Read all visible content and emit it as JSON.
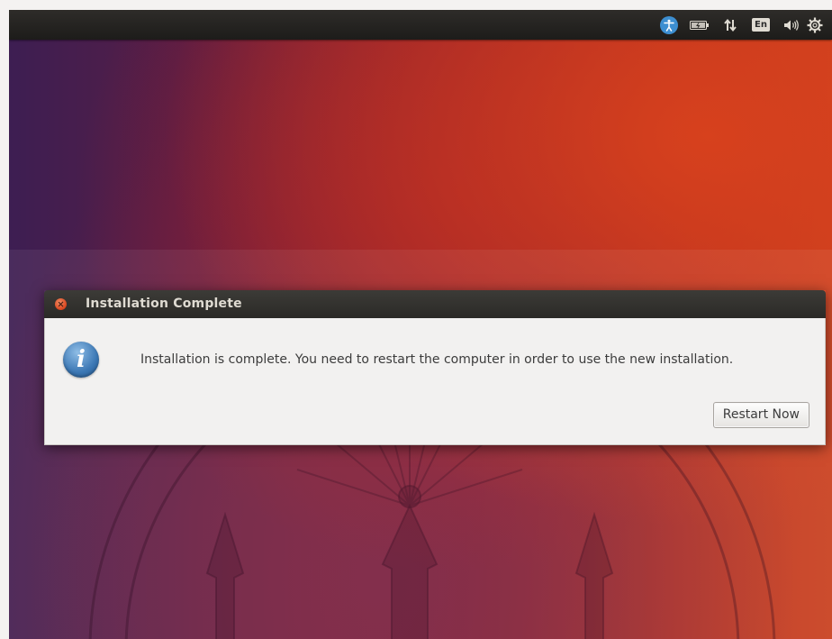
{
  "topbar": {
    "indicators": [
      {
        "icon": "accessibility-icon"
      },
      {
        "icon": "battery-icon"
      },
      {
        "icon": "network-arrows-icon"
      },
      {
        "icon": "keyboard-layout-icon",
        "label": "En"
      },
      {
        "icon": "volume-icon"
      },
      {
        "icon": "gear-icon"
      }
    ]
  },
  "dialog": {
    "title": "Installation Complete",
    "icon": "info-icon",
    "message": "Installation is complete. You need to restart the computer in order to use the new installation.",
    "restart_label": "Restart Now"
  },
  "colors": {
    "panel": "#2b2a27",
    "accent_close": "#d9451e",
    "info_blue": "#3b77b4",
    "wallpaper_orange": "#c9401f",
    "wallpaper_purple": "#3d1e52"
  }
}
